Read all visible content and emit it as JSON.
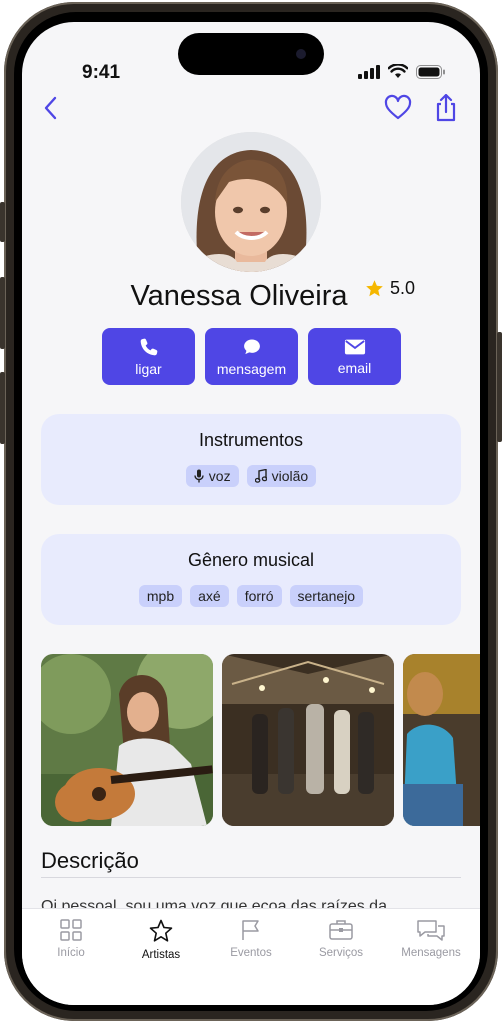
{
  "status": {
    "time": "9:41"
  },
  "profile": {
    "name": "Vanessa Oliveira",
    "rating": "5.0"
  },
  "actions": [
    {
      "label": "ligar",
      "icon": "phone-icon"
    },
    {
      "label": "mensagem",
      "icon": "chat-bubble-icon"
    },
    {
      "label": "email",
      "icon": "envelope-icon"
    }
  ],
  "instruments": {
    "title": "Instrumentos",
    "items": [
      {
        "label": "voz",
        "icon": "microphone-icon"
      },
      {
        "label": "violão",
        "icon": "music-note-icon"
      }
    ]
  },
  "genres": {
    "title": "Gênero musical",
    "items": [
      "mpb",
      "axé",
      "forró",
      "sertanejo"
    ]
  },
  "description": {
    "title": "Descrição",
    "text": "Oi pessoal, sou uma voz que ecoa das raízes da"
  },
  "tabs": [
    {
      "label": "Início",
      "icon": "grid-icon",
      "active": false
    },
    {
      "label": "Artistas",
      "icon": "star-icon",
      "active": true
    },
    {
      "label": "Eventos",
      "icon": "flag-icon",
      "active": false
    },
    {
      "label": "Serviços",
      "icon": "briefcase-icon",
      "active": false
    },
    {
      "label": "Mensagens",
      "icon": "chat-icon",
      "active": false
    }
  ],
  "colors": {
    "accent": "#4f46e5",
    "card": "#e8ebfd",
    "chip": "#c9d0fb",
    "star": "#f5b700"
  }
}
